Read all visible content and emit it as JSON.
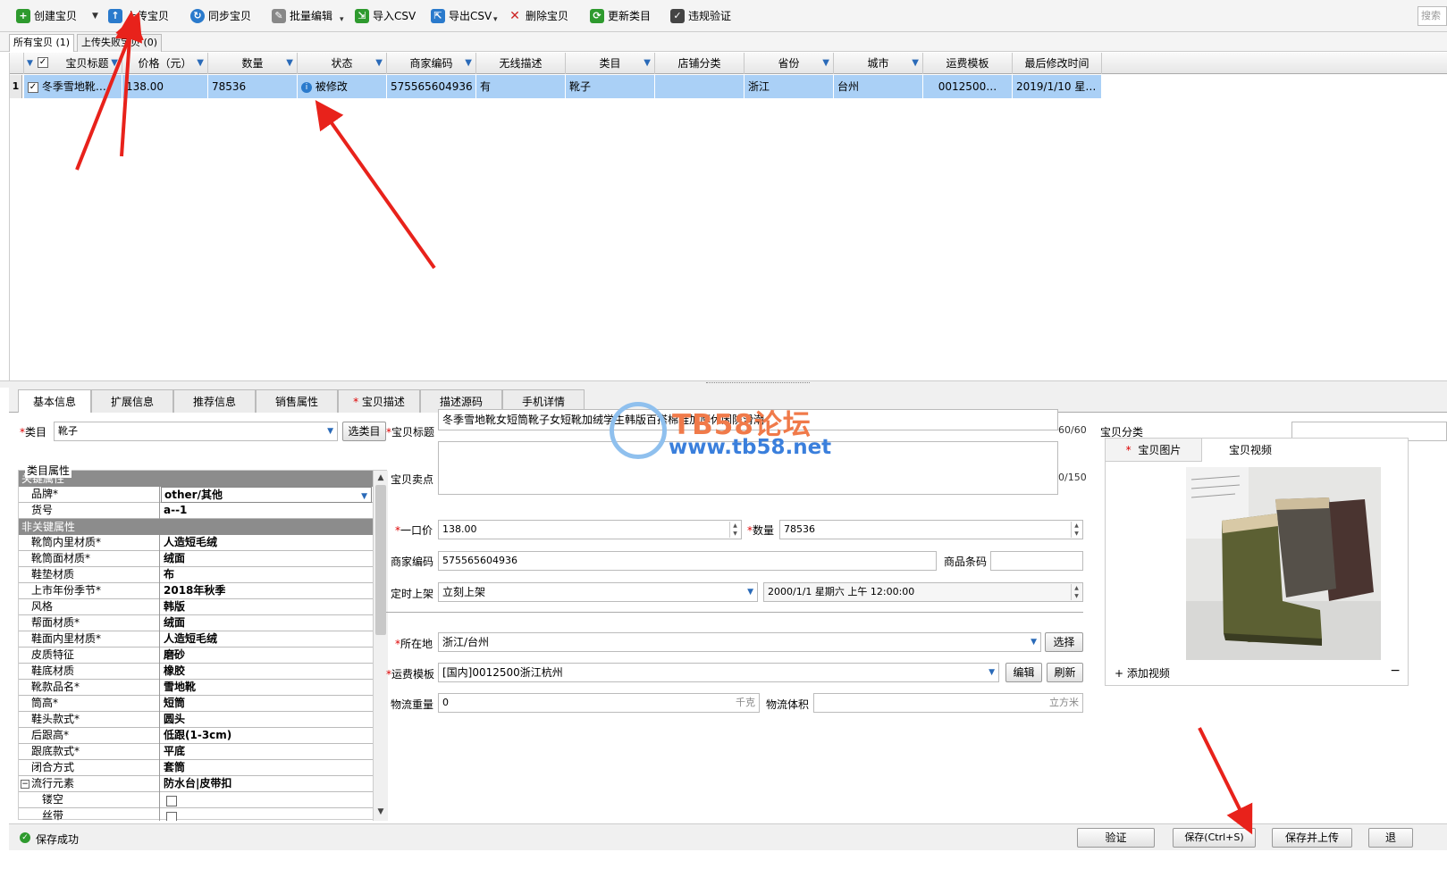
{
  "toolbar": {
    "items": [
      {
        "label": "创建宝贝",
        "icon": "plus-icon",
        "color": "#2e9a2e"
      },
      {
        "label": "上传宝贝",
        "icon": "upload-icon",
        "color": "#2a7acc"
      },
      {
        "label": "同步宝贝",
        "icon": "sync-icon",
        "color": "#2a7acc"
      },
      {
        "label": "批量编辑",
        "icon": "batch-edit-icon",
        "color": "#555555"
      },
      {
        "label": "导入CSV",
        "icon": "import-csv-icon",
        "color": "#2e9a2e"
      },
      {
        "label": "导出CSV",
        "icon": "export-csv-icon",
        "color": "#2a7acc"
      },
      {
        "label": "删除宝贝",
        "icon": "delete-icon",
        "color": "#cc2222"
      },
      {
        "label": "更新类目",
        "icon": "update-category-icon",
        "color": "#2e9a2e"
      },
      {
        "label": "违规验证",
        "icon": "verify-icon",
        "color": "#333333"
      }
    ],
    "search_placeholder": "搜索"
  },
  "list_tabs": [
    {
      "label": "所有宝贝 (1)"
    },
    {
      "label": "上传失败宝贝 (0)"
    }
  ],
  "grid": {
    "columns": [
      "宝贝标题",
      "价格（元）",
      "数量",
      "状态",
      "商家编码",
      "无线描述",
      "类目",
      "店铺分类",
      "省份",
      "城市",
      "运费模板",
      "最后修改时间"
    ],
    "rows": [
      {
        "index": "1",
        "checked": true,
        "title": "冬季雪地靴…",
        "price": "138.00",
        "quantity": "78536",
        "status": "被修改",
        "merchant_code": "575565604936",
        "wireless_desc": "有",
        "category": "靴子",
        "shop_category": "",
        "province": "浙江",
        "city": "台州",
        "shipping_template": "0012500…",
        "modified": "2019/1/10 星…"
      }
    ]
  },
  "form_tabs": [
    "基本信息",
    "扩展信息",
    "推荐信息",
    "销售属性",
    "宝贝描述",
    "描述源码",
    "手机详情"
  ],
  "form": {
    "category_label": "类目",
    "category_value": "靴子",
    "choose_category_btn": "选类目",
    "attrs_legend": "类目属性",
    "key_section": "关键属性",
    "key_attrs": [
      {
        "name": "品牌*",
        "value": "other/其他"
      },
      {
        "name": "货号",
        "value": "a--1"
      }
    ],
    "nonkey_section": "非关键属性",
    "nonkey_attrs": [
      {
        "name": "靴筒内里材质*",
        "value": "人造短毛绒"
      },
      {
        "name": "靴筒面材质*",
        "value": "绒面"
      },
      {
        "name": "鞋垫材质",
        "value": "布"
      },
      {
        "name": "上市年份季节*",
        "value": "2018年秋季"
      },
      {
        "name": "风格",
        "value": "韩版"
      },
      {
        "name": "帮面材质*",
        "value": "绒面"
      },
      {
        "name": "鞋面内里材质*",
        "value": "人造短毛绒"
      },
      {
        "name": "皮质特征",
        "value": "磨砂"
      },
      {
        "name": "鞋底材质",
        "value": "橡胶"
      },
      {
        "name": "靴款品名*",
        "value": "雪地靴"
      },
      {
        "name": "筒高*",
        "value": "短筒"
      },
      {
        "name": "鞋头款式*",
        "value": "圆头"
      },
      {
        "name": "后跟高*",
        "value": "低跟(1-3cm)"
      },
      {
        "name": "跟底款式*",
        "value": "平底"
      },
      {
        "name": "闭合方式",
        "value": "套筒"
      },
      {
        "name": "流行元素",
        "value": "防水台|皮带扣"
      },
      {
        "name": "镂空",
        "value": ""
      },
      {
        "name": "丝带",
        "value": ""
      }
    ],
    "title_label": "宝贝标题",
    "title_value": "冬季雪地靴女短筒靴子女短靴加绒学生韩版百搭棉鞋加厚休闲防滑潮",
    "title_count": "60/60",
    "selling_label": "宝贝卖点",
    "selling_value": "",
    "selling_count": "0/150",
    "price_label": "一口价",
    "price_value": "138.00",
    "qty_label": "数量",
    "qty_value": "78536",
    "merchant_label": "商家编码",
    "merchant_value": "575565604936",
    "barcode_label": "商品条码",
    "barcode_value": "",
    "schedule_label": "定时上架",
    "schedule_value": "立刻上架",
    "schedule_datetime": "2000/1/1  星期六  上午  12:00:00",
    "location_label": "所在地",
    "location_value": "浙江/台州",
    "location_btn": "选择",
    "shipping_label": "运费模板",
    "shipping_value": "[国内]0012500浙江杭州",
    "edit_btn": "编辑",
    "refresh_btn": "刷新",
    "weight_label": "物流重量",
    "weight_value": "0",
    "weight_unit": "千克",
    "volume_label": "物流体积",
    "volume_value": "",
    "volume_unit": "立方米",
    "shop_cat_label": "宝贝分类",
    "media_tabs": [
      "宝贝图片",
      "宝贝视频"
    ],
    "add_video": "添加视频",
    "media_minus": "−"
  },
  "watermark": {
    "line1": "TB58论坛",
    "line2": "www.tb58.net"
  },
  "statusbar": {
    "message": "保存成功",
    "verify_btn": "验证",
    "save_btn": "保存(Ctrl+S)",
    "save_upload_btn": "保存并上传",
    "extra_btn": "退"
  },
  "colors": {
    "selected_row": "#aad0f6",
    "filter_icon": "#2a6ab8",
    "required": "#dd0000",
    "annotation_arrow": "#e8221b"
  }
}
